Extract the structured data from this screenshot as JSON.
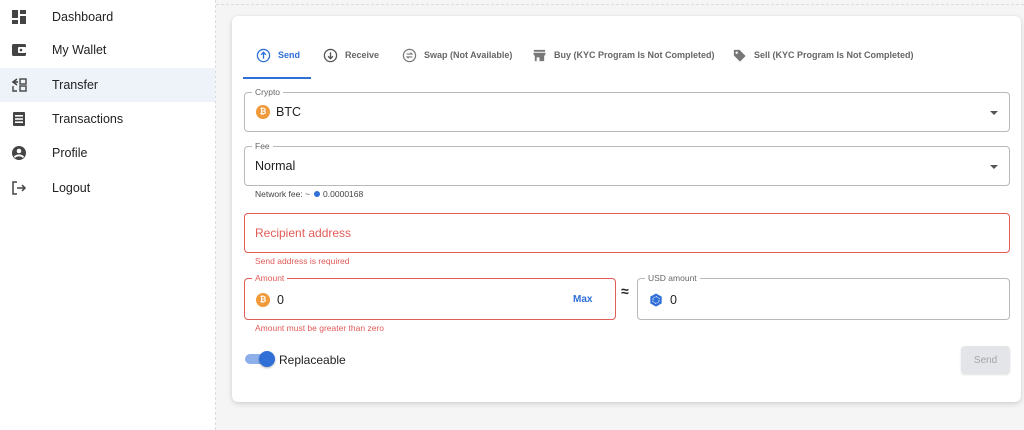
{
  "sidebar": {
    "items": [
      {
        "label": "Dashboard",
        "icon": "dashboard-icon",
        "active": false
      },
      {
        "label": "My Wallet",
        "icon": "wallet-icon",
        "active": false
      },
      {
        "label": "Transfer",
        "icon": "transfer-icon",
        "active": true
      },
      {
        "label": "Transactions",
        "icon": "transactions-icon",
        "active": false
      },
      {
        "label": "Profile",
        "icon": "profile-icon",
        "active": false
      },
      {
        "label": "Logout",
        "icon": "logout-icon",
        "active": false
      }
    ]
  },
  "tabs": [
    {
      "label": "Send",
      "icon": "arrow-up-circle-icon",
      "active": true
    },
    {
      "label": "Receive",
      "icon": "arrow-down-circle-icon",
      "active": false
    },
    {
      "label": "Swap (Not Available)",
      "icon": "swap-icon",
      "active": false
    },
    {
      "label": "Buy (KYC Program Is Not Completed)",
      "icon": "store-icon",
      "active": false
    },
    {
      "label": "Sell (KYC Program Is Not Completed)",
      "icon": "tag-icon",
      "active": false
    }
  ],
  "form": {
    "crypto": {
      "label": "Crypto",
      "value": "BTC",
      "icon": "bitcoin-icon"
    },
    "fee": {
      "label": "Fee",
      "value": "Normal",
      "network_fee_prefix": "Network fee: ~",
      "network_fee_value": "0.0000168"
    },
    "recipient": {
      "placeholder": "Recipient address",
      "error": "Send address is required"
    },
    "amount": {
      "label": "Amount",
      "value": "0",
      "max_label": "Max",
      "error": "Amount must be greater than zero"
    },
    "approx_symbol": "≈",
    "usd_amount": {
      "label": "USD amount",
      "value": "0"
    },
    "replaceable": {
      "label": "Replaceable",
      "enabled": true
    },
    "send_label": "Send"
  },
  "colors": {
    "accent": "#2f6fd6",
    "error": "#e25b57",
    "bitcoin": "#f09a3a",
    "active_nav_bg": "#eef2f9"
  }
}
